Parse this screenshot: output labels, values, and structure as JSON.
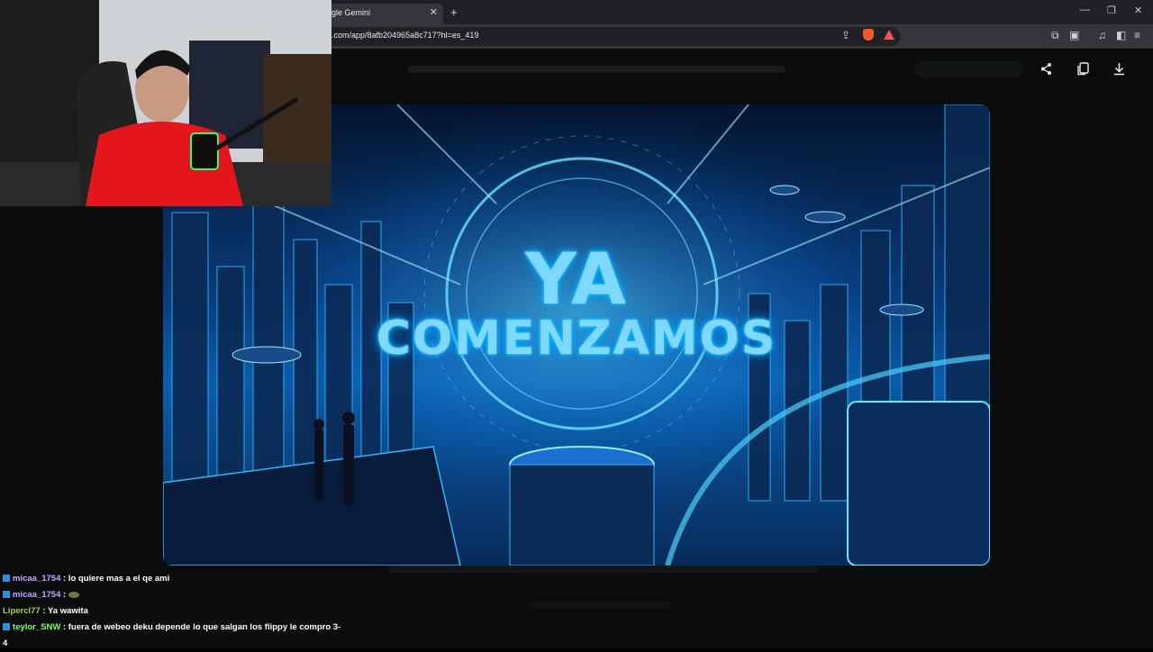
{
  "browser": {
    "tab_title": "gle Gemini",
    "tab_close": "✕",
    "new_tab": "+",
    "url": ".com/app/8afb204965a8c717?hl=es_419"
  },
  "window_controls": {
    "minimize": "—",
    "restore": "❐",
    "close": "✕"
  },
  "page_actions": {
    "share": "share-icon",
    "copy": "copy-icon",
    "download": "download-icon"
  },
  "image": {
    "title_line1": "YA",
    "title_line2": "COMENZAMOS"
  },
  "chat": {
    "messages": [
      {
        "user": "micaa_1754",
        "text": ": lo quiere mas a el qe ami"
      },
      {
        "user": "micaa_1754",
        "text": ":"
      },
      {
        "user": "Lipercl77",
        "text": ": Ya wawita"
      },
      {
        "user": "teylor_SNW",
        "text": ": fuera de webeo deku depende lo que salgan los flippy le compro 3-"
      },
      {
        "user": "",
        "text": "4"
      }
    ]
  },
  "colors": {
    "accent": "#00c6ff",
    "chat_user_1": "#cba4ff",
    "chat_user_2": "#9bd45a",
    "chat_user_3": "#7dff6a"
  }
}
